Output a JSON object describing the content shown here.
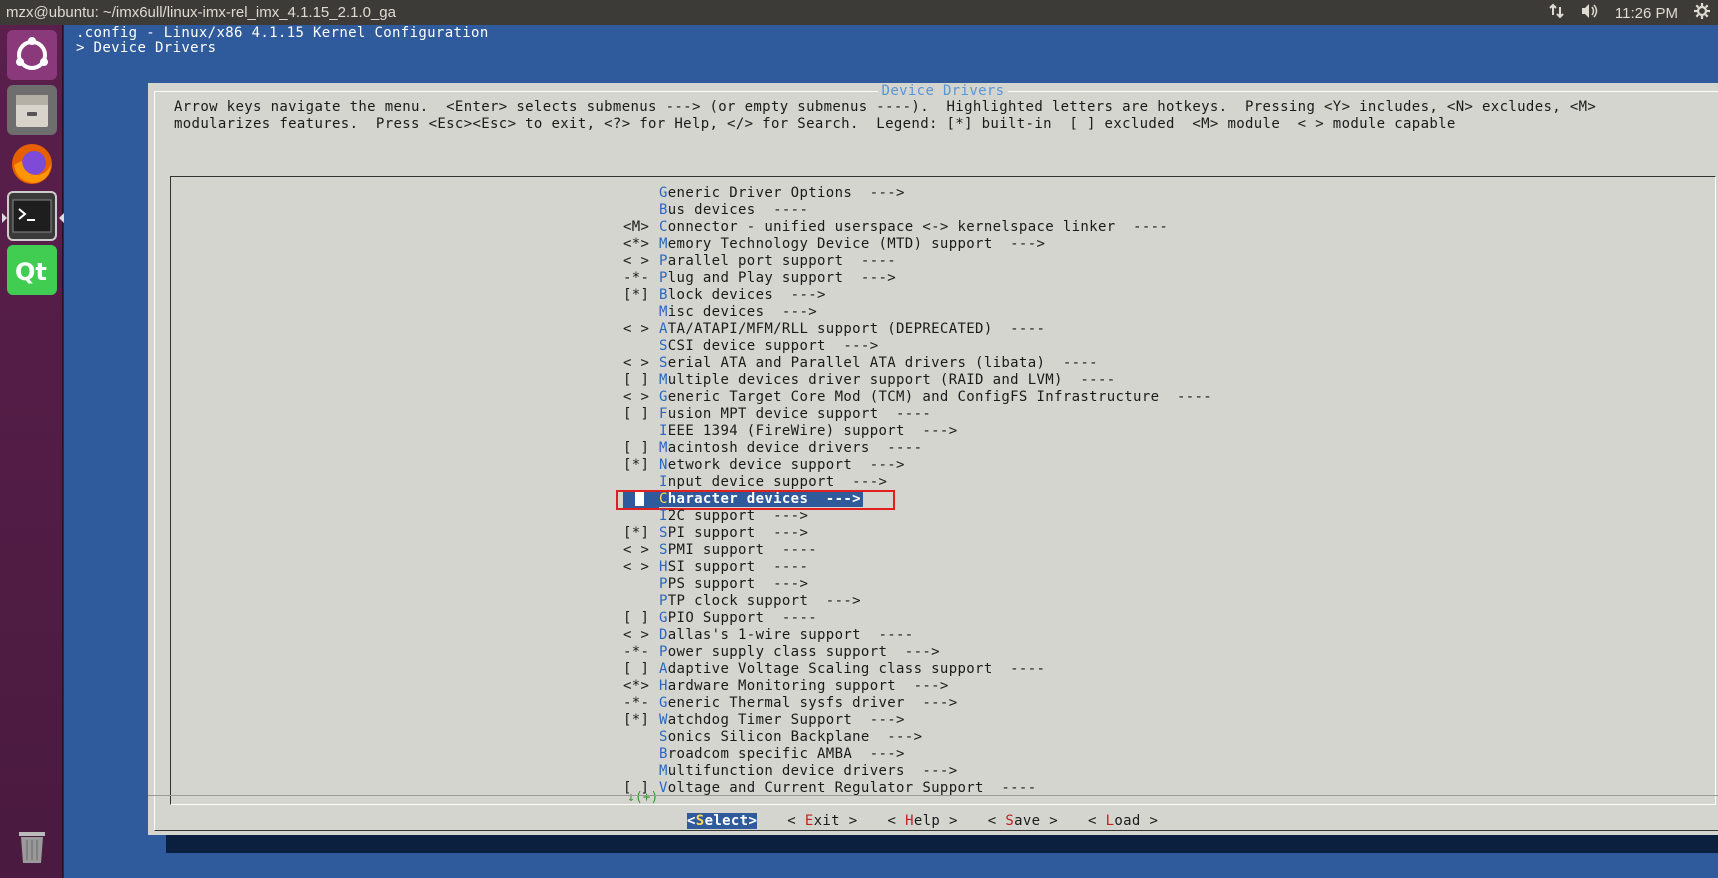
{
  "top_panel": {
    "window_title": "mzx@ubuntu: ~/imx6ull/linux-imx-rel_imx_4.1.15_2.1.0_ga",
    "time": "11:26 PM"
  },
  "launcher": {
    "items": [
      {
        "name": "Ubuntu Dash"
      },
      {
        "name": "Files"
      },
      {
        "name": "Firefox"
      },
      {
        "name": "Terminal"
      },
      {
        "name": "Qt Creator"
      },
      {
        "name": "Trash"
      }
    ]
  },
  "terminal": {
    "line1": ".config - Linux/x86 4.1.15 Kernel Configuration",
    "line2": "> Device Drivers"
  },
  "dialog": {
    "title": "Device Drivers",
    "help_line1": "Arrow keys navigate the menu.  <Enter> selects submenus ---> (or empty submenus ----).  Highlighted letters are hotkeys.  Pressing <Y> includes, <N> excludes, <M>",
    "help_line2": "modularizes features.  Press <Esc><Esc> to exit, <?> for Help, </> for Search.  Legend: [*] built-in  [ ] excluded  <M> module  < > module capable",
    "more_indicator": "↓(+)",
    "items": [
      {
        "state": "   ",
        "hotkey": "G",
        "rest": "eneric Driver Options  --->"
      },
      {
        "state": "   ",
        "hotkey": "B",
        "rest": "us devices  ----"
      },
      {
        "state": "<M>",
        "hotkey": "C",
        "rest": "onnector - unified userspace <-> kernelspace linker  ----"
      },
      {
        "state": "<*>",
        "hotkey": "M",
        "rest": "emory Technology Device (MTD) support  --->"
      },
      {
        "state": "< >",
        "hotkey": "P",
        "rest": "arallel port support  ----"
      },
      {
        "state": "-*-",
        "hotkey": "P",
        "rest": "lug and Play support  --->"
      },
      {
        "state": "[*]",
        "hotkey": "B",
        "rest": "lock devices  --->"
      },
      {
        "state": "   ",
        "hotkey": "M",
        "rest": "isc devices  --->"
      },
      {
        "state": "< >",
        "hotkey": "A",
        "rest": "TA/ATAPI/MFM/RLL support (DEPRECATED)  ----"
      },
      {
        "state": "   ",
        "hotkey": "S",
        "rest": "CSI device support  --->"
      },
      {
        "state": "< >",
        "hotkey": "S",
        "rest": "erial ATA and Parallel ATA drivers (libata)  ----"
      },
      {
        "state": "[ ]",
        "hotkey": "M",
        "rest": "ultiple devices driver support (RAID and LVM)  ----"
      },
      {
        "state": "< >",
        "hotkey": "G",
        "rest": "eneric Target Core Mod (TCM) and ConfigFS Infrastructure  ----"
      },
      {
        "state": "[ ]",
        "hotkey": "F",
        "rest": "usion MPT device support  ----"
      },
      {
        "state": "   ",
        "hotkey": "I",
        "rest": "EEE 1394 (FireWire) support  --->"
      },
      {
        "state": "[ ]",
        "hotkey": "M",
        "rest": "acintosh device drivers  ----"
      },
      {
        "state": "[*]",
        "hotkey": "N",
        "rest": "etwork device support  --->"
      },
      {
        "state": "   ",
        "hotkey": "I",
        "rest": "nput device support  --->"
      },
      {
        "state": "   ",
        "hotkey": "C",
        "rest": "haracter devices  --->",
        "selected": true
      },
      {
        "state": "   ",
        "hotkey": "I",
        "rest": "2C support  --->"
      },
      {
        "state": "[*]",
        "hotkey": "S",
        "rest": "PI support  --->"
      },
      {
        "state": "< >",
        "hotkey": "S",
        "rest": "PMI support  ----"
      },
      {
        "state": "< >",
        "hotkey": "H",
        "rest": "SI support  ----"
      },
      {
        "state": "   ",
        "hotkey": "P",
        "rest": "PS support  --->"
      },
      {
        "state": "   ",
        "hotkey": "P",
        "rest": "TP clock support  --->"
      },
      {
        "state": "[ ]",
        "hotkey": "G",
        "rest": "PIO Support  ----"
      },
      {
        "state": "< >",
        "hotkey": "D",
        "rest": "allas's 1-wire support  ----"
      },
      {
        "state": "-*-",
        "hotkey": "P",
        "rest": "ower supply class support  --->"
      },
      {
        "state": "[ ]",
        "hotkey": "A",
        "rest": "daptive Voltage Scaling class support  ----"
      },
      {
        "state": "<*>",
        "hotkey": "H",
        "rest": "ardware Monitoring support  --->"
      },
      {
        "state": "-*-",
        "hotkey": "G",
        "rest": "eneric Thermal sysfs driver  --->"
      },
      {
        "state": "[*]",
        "hotkey": "W",
        "rest": "atchdog Timer Support  --->"
      },
      {
        "state": "   ",
        "hotkey": "S",
        "rest": "onics Silicon Backplane  --->"
      },
      {
        "state": "   ",
        "hotkey": "B",
        "rest": "roadcom specific AMBA  --->"
      },
      {
        "state": "   ",
        "hotkey": "M",
        "rest": "ultifunction device drivers  --->"
      },
      {
        "state": "[ ]",
        "hotkey": "V",
        "rest": "oltage and Current Regulator Support  ----"
      }
    ],
    "buttons": [
      {
        "pre": "<",
        "hotkey": "S",
        "rest": "elect>",
        "active": true
      },
      {
        "pre": "< ",
        "hotkey": "E",
        "rest": "xit >"
      },
      {
        "pre": "< ",
        "hotkey": "H",
        "rest": "elp >"
      },
      {
        "pre": "< ",
        "hotkey": "S",
        "rest": "ave >"
      },
      {
        "pre": "< ",
        "hotkey": "L",
        "rest": "oad >"
      }
    ]
  },
  "colors": {
    "terminal_bg": "#2f5a9b",
    "dialog_bg": "#d5d5cf",
    "hotkey_menu": "#2a66c2",
    "hotkey_button": "#c0211f",
    "selection_outline": "#e02020"
  }
}
